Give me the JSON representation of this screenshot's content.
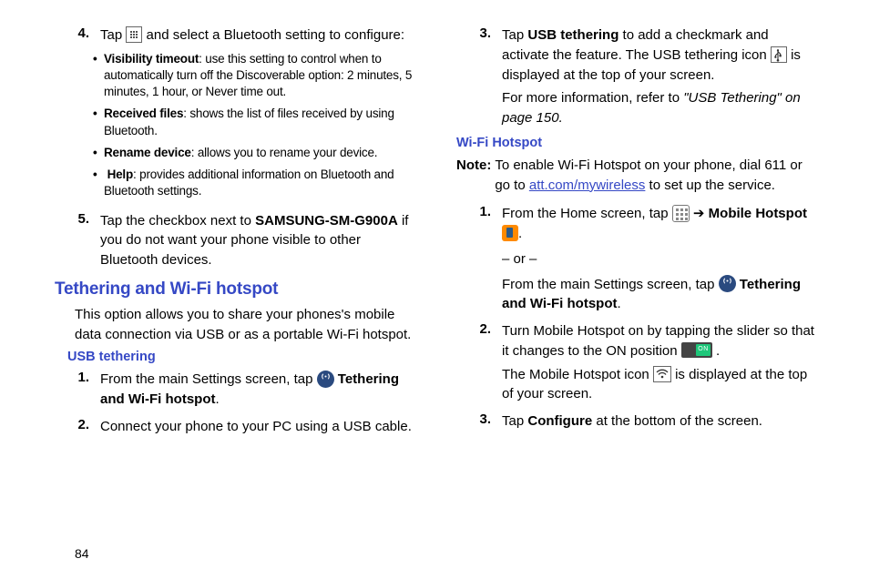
{
  "col1": {
    "step4": {
      "num": "4.",
      "lead": "Tap ",
      "tail": " and select a Bluetooth setting to configure:",
      "b1_label": "Visibility timeout",
      "b1_text": ": use this setting to control when to automatically turn off the Discoverable option: 2 minutes, 5 minutes, 1 hour, or Never time out.",
      "b2_label": "Received files",
      "b2_text": ": shows the list of files received by using Bluetooth.",
      "b3_label": "Rename device",
      "b3_text": ": allows you to rename your device.",
      "b4_label": "Help",
      "b4_text": ": provides additional information on Bluetooth and Bluetooth settings."
    },
    "step5": {
      "num": "5.",
      "pre": "Tap the checkbox next to ",
      "bold": "SAMSUNG-SM-G900A",
      "post": " if you do not want your phone visible to other Bluetooth devices."
    },
    "h2": "Tethering and Wi-Fi hotspot",
    "intro": "This option allows you to share your phones's mobile data connection via USB or as a portable Wi-Fi hotspot.",
    "h3": "USB tethering",
    "u1": {
      "num": "1.",
      "pre": "From the main Settings screen, tap ",
      "bold": "Tethering and Wi-Fi hotspot",
      "post": "."
    },
    "u2": {
      "num": "2.",
      "text": "Connect your phone to your PC using a USB cable."
    }
  },
  "col2": {
    "u3": {
      "num": "3.",
      "pre": "Tap ",
      "b1": "USB tethering",
      "mid1": " to add a checkmark and activate the feature. The USB tethering icon ",
      "mid2": " is displayed at the top of your screen.",
      "ref_pre": "For more information, refer to ",
      "ref_ital": "\"USB Tethering\"  on page 150.",
      "ref_post": ""
    },
    "h3": "Wi-Fi Hotspot",
    "note": {
      "label": "Note:",
      "pre": " To enable Wi-Fi Hotspot on your phone, dial 611 or go to ",
      "link": "att.com/mywireless",
      "post": " to set up the service."
    },
    "w1": {
      "num": "1.",
      "pre": "From the Home screen, tap ",
      "arrow": " ➔ ",
      "bold": "Mobile Hotspot",
      "post_dot": ".",
      "or": "– or –",
      "alt_pre": "From the main Settings screen, tap ",
      "alt_bold": "Tethering and Wi-Fi hotspot",
      "alt_post": "."
    },
    "w2": {
      "num": "2.",
      "pre": "Turn Mobile Hotspot on by tapping the slider so that it changes to the ON position  ",
      "dot": ".",
      "line2_pre": "The Mobile Hotspot icon ",
      "line2_post": " is displayed at the top of your screen."
    },
    "w3": {
      "num": "3.",
      "pre": "Tap ",
      "bold": "Configure",
      "post": " at the bottom of the screen."
    }
  },
  "page": "84"
}
